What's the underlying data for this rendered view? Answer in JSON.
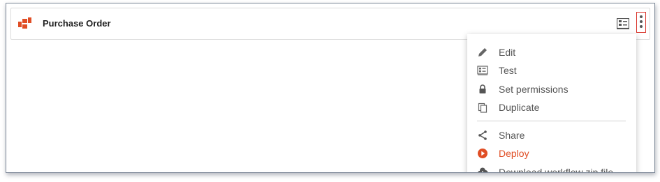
{
  "card": {
    "title": "Purchase Order",
    "logo_icon": "puzzle-logo-icon",
    "brand_color": "#e04e25"
  },
  "toolbar": {
    "test_icon": "test-checklist-icon",
    "more_icon": "more-vertical-icon",
    "highlight_color": "#d9342b"
  },
  "menu": {
    "items": [
      {
        "label": "Edit",
        "icon": "pencil-icon"
      },
      {
        "label": "Test",
        "icon": "checklist-icon"
      },
      {
        "label": "Set permissions",
        "icon": "lock-icon"
      },
      {
        "label": "Duplicate",
        "icon": "copy-icon"
      },
      {
        "label": "Share",
        "icon": "share-icon"
      },
      {
        "label": "Deploy",
        "icon": "play-circle-icon"
      },
      {
        "label": "Download workflow zip file",
        "icon": "cloud-download-icon"
      }
    ]
  }
}
